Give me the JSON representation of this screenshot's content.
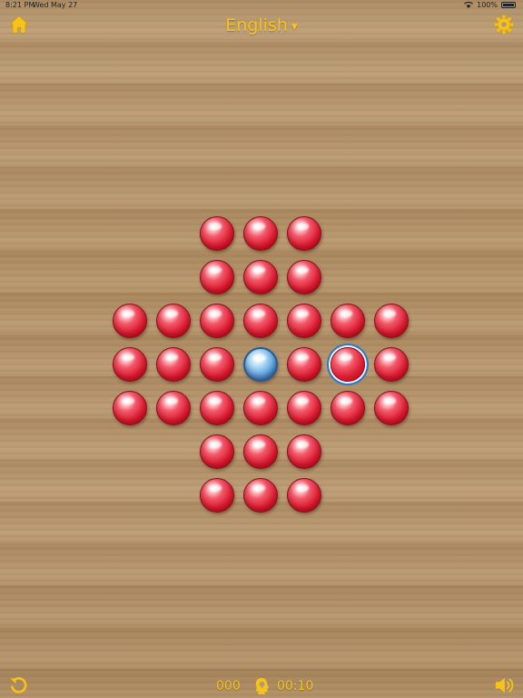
{
  "status_bar": {
    "time": "8:21 PM",
    "date": "Wed May 27",
    "battery": "100%"
  },
  "header": {
    "language": "English",
    "home_icon": "home-icon",
    "settings_icon": "gear-icon"
  },
  "board": {
    "type": "peg-solitaire-english-cross",
    "rows": 7,
    "cols": 7,
    "peg_color": "#dc1c32",
    "empty_color": "#3f8fd2",
    "accent_color": "#f7c21a",
    "layout": [
      [
        "",
        "",
        "peg",
        "peg",
        "peg",
        "",
        ""
      ],
      [
        "",
        "",
        "peg",
        "peg",
        "peg",
        "",
        ""
      ],
      [
        "peg",
        "peg",
        "peg",
        "peg",
        "peg",
        "peg",
        "peg"
      ],
      [
        "peg",
        "peg",
        "peg",
        "empty",
        "peg",
        "selected",
        "peg"
      ],
      [
        "peg",
        "peg",
        "peg",
        "peg",
        "peg",
        "peg",
        "peg"
      ],
      [
        "",
        "",
        "peg",
        "peg",
        "peg",
        "",
        ""
      ],
      [
        "",
        "",
        "peg",
        "peg",
        "peg",
        "",
        ""
      ]
    ]
  },
  "footer": {
    "moves": "000",
    "timer": "00:10",
    "undo_icon": "undo-icon",
    "hint_icon": "lightbulb-head-icon",
    "sound_icon": "speaker-icon"
  }
}
